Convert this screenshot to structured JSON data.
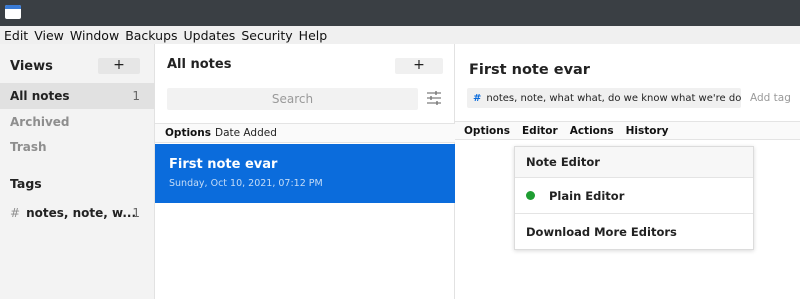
{
  "colors": {
    "accent": "#0b6cdc",
    "active_indicator": "#1f9d32",
    "titlebar": "#3a3f44"
  },
  "menubar": {
    "items": [
      "Edit",
      "View",
      "Window",
      "Backups",
      "Updates",
      "Security",
      "Help"
    ]
  },
  "sidebar": {
    "views_header": "Views",
    "add_view_label": "+",
    "items": [
      {
        "label": "All notes",
        "count": "1"
      },
      {
        "label": "Archived",
        "count": ""
      },
      {
        "label": "Trash",
        "count": ""
      }
    ],
    "tags_header": "Tags",
    "tags": [
      {
        "label": "notes, note, w...",
        "count": "1"
      }
    ]
  },
  "notes_list": {
    "title": "All notes",
    "new_note_label": "+",
    "search_placeholder": "Search",
    "options_label": "Options",
    "sort_value": "Date Added",
    "notes": [
      {
        "title": "First note evar",
        "date": "Sunday, Oct 10, 2021, 07:12 PM"
      }
    ]
  },
  "editor": {
    "title": "First note evar",
    "tags_text": "notes, note, what what, do we know what we're do...",
    "add_tag_label": "Add tag",
    "toolbar": [
      "Options",
      "Editor",
      "Actions",
      "History"
    ],
    "editor_menu": {
      "header": "Note Editor",
      "items": [
        "Plain Editor",
        "Download More Editors"
      ]
    }
  }
}
